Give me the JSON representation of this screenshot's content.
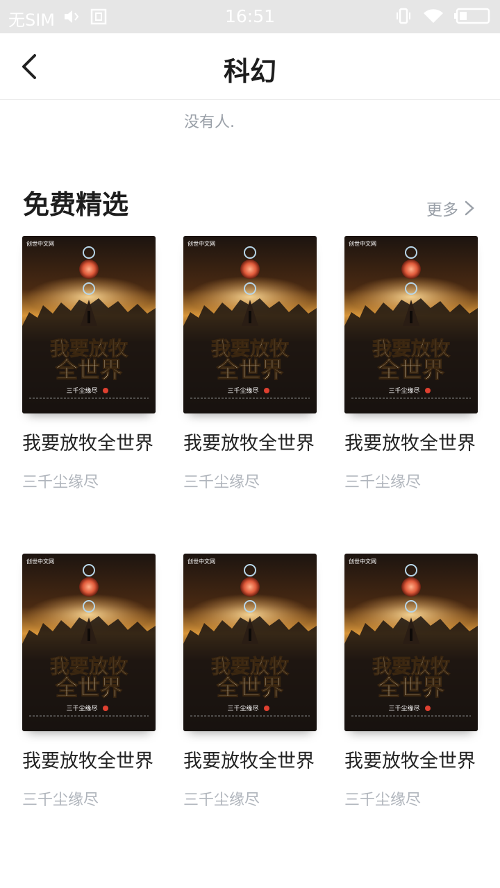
{
  "status_bar": {
    "carrier": "无SIM",
    "time": "16:51"
  },
  "header": {
    "title": "科幻",
    "back_icon": "chevron-left-icon"
  },
  "snippet_text": "没有人.",
  "section": {
    "title": "免费精选",
    "more_label": "更多"
  },
  "books": [
    {
      "title": "我要放牧全世界",
      "author": "三千尘缘尽",
      "cover_title": "我要放牧全世界",
      "cover_author": "三千尘缘尽"
    },
    {
      "title": "我要放牧全世界",
      "author": "三千尘缘尽",
      "cover_title": "我要放牧全世界",
      "cover_author": "三千尘缘尽"
    },
    {
      "title": "我要放牧全世界",
      "author": "三千尘缘尽",
      "cover_title": "我要放牧全世界",
      "cover_author": "三千尘缘尽"
    },
    {
      "title": "我要放牧全世界",
      "author": "三千尘缘尽",
      "cover_title": "我要放牧全世界",
      "cover_author": "三千尘缘尽"
    },
    {
      "title": "我要放牧全世界",
      "author": "三千尘缘尽",
      "cover_title": "我要放牧全世界",
      "cover_author": "三千尘缘尽"
    },
    {
      "title": "我要放牧全世界",
      "author": "三千尘缘尽",
      "cover_title": "我要放牧全世界",
      "cover_author": "三千尘缘尽"
    }
  ]
}
